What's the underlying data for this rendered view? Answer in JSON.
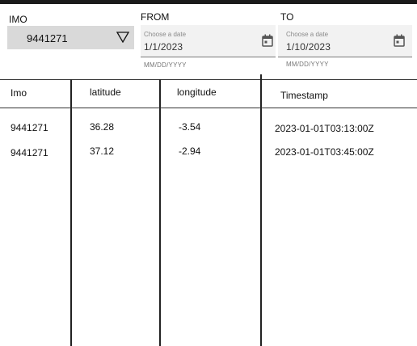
{
  "filters": {
    "imo": {
      "label": "IMO",
      "selected": "9441271"
    },
    "from": {
      "label": "FROM",
      "hint": "Choose a date",
      "value": "1/1/2023",
      "helper": "MM/DD/YYYY"
    },
    "to": {
      "label": "TO",
      "hint": "Choose a date",
      "value": "1/10/2023",
      "helper": "MM/DD/YYYY"
    }
  },
  "table": {
    "columns": [
      "Imo",
      "latitude",
      "longitude",
      "Timestamp"
    ],
    "rows": [
      [
        "9441271",
        "36.28",
        "-3.54",
        "2023-01-01T03:13:00Z"
      ],
      [
        "9441271",
        "37.12",
        "-2.94",
        "2023-01-01T03:45:00Z"
      ]
    ]
  },
  "colors": {
    "select_bg": "#d9d9d9",
    "date_bg": "#f2f2f2",
    "topbar": "#1a1a1a"
  },
  "icons": [
    "triangle-down-icon",
    "calendar-icon"
  ]
}
